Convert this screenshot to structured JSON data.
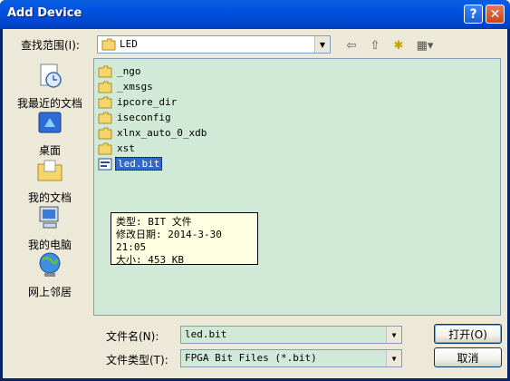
{
  "window": {
    "title": "Add Device",
    "help_label": "?",
    "close_label": "✕"
  },
  "lookin": {
    "label": "查找范围(I):",
    "value": "LED"
  },
  "toolbar": {
    "back_glyph": "⇦",
    "up_glyph": "⇧",
    "newfolder_glyph": "✱",
    "views_glyph": "▦▾"
  },
  "places": [
    {
      "label": "我最近的文档",
      "icon": "recent-documents-icon"
    },
    {
      "label": "桌面",
      "icon": "desktop-icon"
    },
    {
      "label": "我的文档",
      "icon": "my-documents-icon"
    },
    {
      "label": "我的电脑",
      "icon": "my-computer-icon"
    },
    {
      "label": "网上邻居",
      "icon": "network-places-icon"
    }
  ],
  "files": [
    {
      "name": "_ngo",
      "type": "folder"
    },
    {
      "name": "_xmsgs",
      "type": "folder"
    },
    {
      "name": "ipcore_dir",
      "type": "folder"
    },
    {
      "name": "iseconfig",
      "type": "folder"
    },
    {
      "name": "xlnx_auto_0_xdb",
      "type": "folder"
    },
    {
      "name": "xst",
      "type": "folder"
    },
    {
      "name": "led.bit",
      "type": "file",
      "selected": true
    }
  ],
  "tooltip": {
    "type_line": "类型: BIT 文件",
    "date_line": "修改日期: 2014-3-30 21:05",
    "size_line": "大小: 453 KB"
  },
  "filename": {
    "label": "文件名(N):",
    "value": "led.bit"
  },
  "filetype": {
    "label": "文件类型(T):",
    "value": "FPGA Bit Files (*.bit)"
  },
  "buttons": {
    "open": "打开(O)",
    "cancel": "取消"
  },
  "colors": {
    "list_bg": "#d1ead7",
    "title_blue": "#0054e3",
    "selection": "#316ac5"
  }
}
